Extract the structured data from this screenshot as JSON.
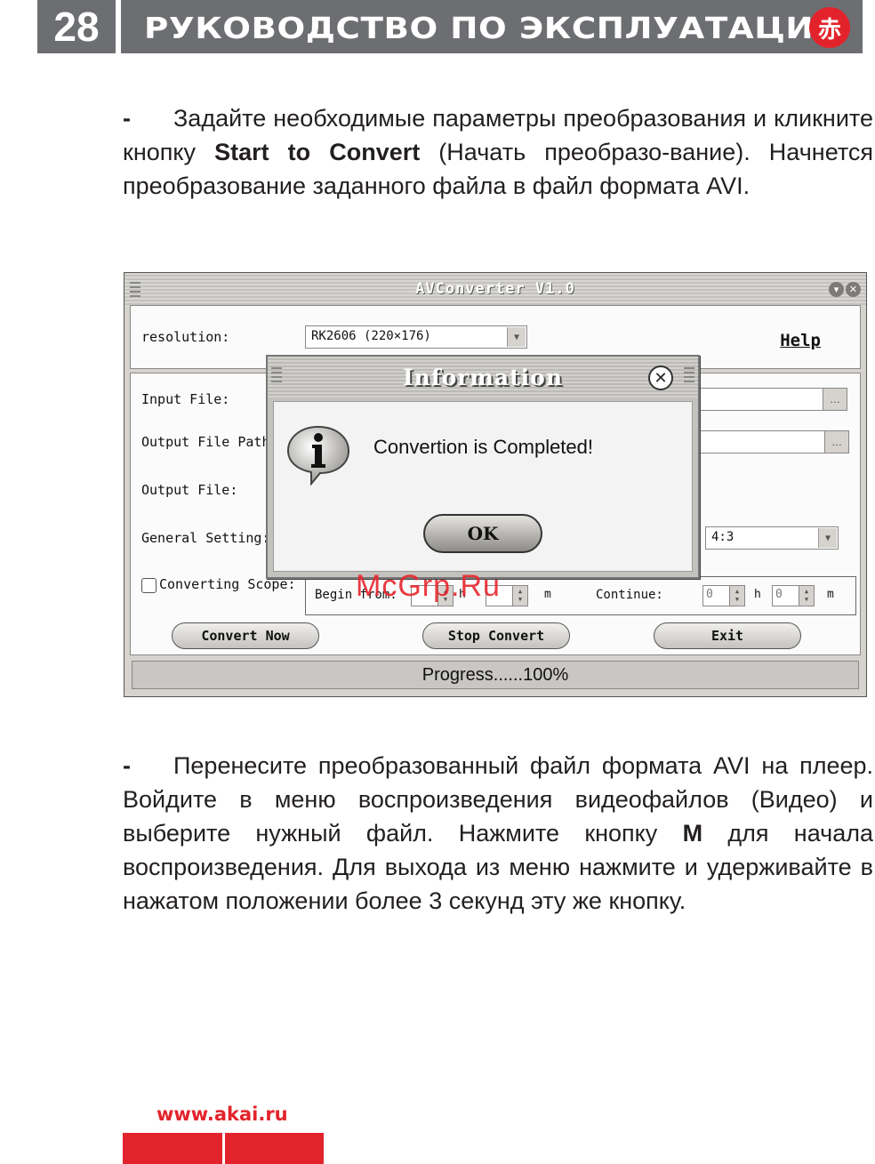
{
  "header": {
    "page_number": "28",
    "title": "РУКОВОДСТВО ПО ЭКСПЛУАТАЦИИ",
    "logo_glyph": "赤"
  },
  "para1": {
    "dash": "-",
    "before": "Задайте необходимые параметры преобразования и кликните кнопку ",
    "bold": "Start to Convert",
    "after": " (Начать преобразо-вание). Начнется преобразование заданного файла в файл формата AVI."
  },
  "screenshot": {
    "window_title": "AVConverter V1.0",
    "resolution_label": "resolution:",
    "resolution_value": "RK2606 (220×176)",
    "help_label": "Help",
    "input_file_label": "Input File:",
    "output_path_label": "Output File Path",
    "output_file_label": "Output File:",
    "general_setting_label": "General Setting:",
    "aspect_value": "4:3",
    "converting_scope_label": "Converting Scope:",
    "begin_from_label": "Begin from:",
    "h_label": "h",
    "m_label": "m",
    "continue_label": "Continue:",
    "continue_h_value": "0",
    "continue_m_value": "0",
    "convert_now_label": "Convert Now",
    "stop_convert_label": "Stop Convert",
    "exit_label": "Exit",
    "progress_text": "Progress......100%",
    "dialog": {
      "title": "Information",
      "message": "Convertion is Completed!",
      "ok_label": "OK"
    }
  },
  "watermark": "McGrp.Ru",
  "para2": {
    "dash": "-",
    "before": "Перенесите преобразованный файл формата AVI на плеер. Войдите в меню воспроизведения видеофайлов (Видео) и выберите нужный файл. Нажмите кнопку ",
    "bold": "M",
    "after": " для начала воспроизведения.  Для выхода из меню нажмите и удерживайте в нажатом положении более 3 секунд эту же кнопку."
  },
  "footer": {
    "site": "www.akai.ru"
  },
  "colors": {
    "header_gray": "#6d6e71",
    "brand_red": "#e3232b"
  }
}
